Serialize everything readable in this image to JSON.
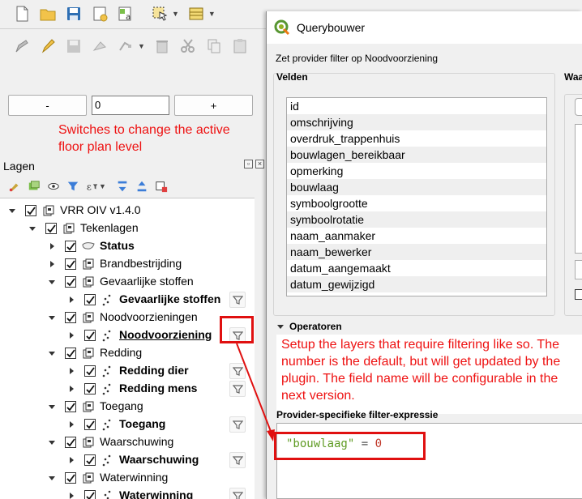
{
  "note_floor": "Switches to change the active floor plan level",
  "floor": {
    "minus_label": "-",
    "value": "0",
    "plus_label": "+"
  },
  "layers": {
    "title": "Lagen",
    "tree": [
      {
        "label": "VRR OIV v1.4.0",
        "depth": 0,
        "expanded": true,
        "checked": true,
        "icon": "group-icon",
        "bold": false
      },
      {
        "label": "Tekenlagen",
        "depth": 1,
        "expanded": true,
        "checked": true,
        "icon": "group-icon",
        "bold": false
      },
      {
        "label": "Status",
        "depth": 2,
        "expanded": false,
        "checked": true,
        "icon": "polygon-icon",
        "bold": true
      },
      {
        "label": "Brandbestrijding",
        "depth": 2,
        "expanded": false,
        "checked": true,
        "icon": "group-icon",
        "bold": false
      },
      {
        "label": "Gevaarlijke stoffen",
        "depth": 2,
        "expanded": true,
        "checked": true,
        "icon": "group-icon",
        "bold": false
      },
      {
        "label": "Gevaarlijke stoffen",
        "depth": 3,
        "expanded": false,
        "checked": true,
        "icon": "point-layer-icon",
        "bold": true,
        "filter": true
      },
      {
        "label": "Noodvoorzieningen",
        "depth": 2,
        "expanded": true,
        "checked": true,
        "icon": "group-icon",
        "bold": false
      },
      {
        "label": "Noodvoorziening",
        "depth": 3,
        "expanded": false,
        "checked": true,
        "icon": "point-layer-icon",
        "bold": true,
        "filter": true,
        "underline": true
      },
      {
        "label": "Redding",
        "depth": 2,
        "expanded": true,
        "checked": true,
        "icon": "group-icon",
        "bold": false
      },
      {
        "label": "Redding dier",
        "depth": 3,
        "expanded": false,
        "checked": true,
        "icon": "point-layer-icon",
        "bold": true,
        "filter": true
      },
      {
        "label": "Redding mens",
        "depth": 3,
        "expanded": false,
        "checked": true,
        "icon": "point-layer-icon",
        "bold": true,
        "filter": true
      },
      {
        "label": "Toegang",
        "depth": 2,
        "expanded": true,
        "checked": true,
        "icon": "group-icon",
        "bold": false
      },
      {
        "label": "Toegang",
        "depth": 3,
        "expanded": false,
        "checked": true,
        "icon": "point-layer-icon",
        "bold": true,
        "filter": true
      },
      {
        "label": "Waarschuwing",
        "depth": 2,
        "expanded": true,
        "checked": true,
        "icon": "group-icon",
        "bold": false
      },
      {
        "label": "Waarschuwing",
        "depth": 3,
        "expanded": false,
        "checked": true,
        "icon": "point-layer-icon",
        "bold": true,
        "filter": true
      },
      {
        "label": "Waterwinning",
        "depth": 2,
        "expanded": true,
        "checked": true,
        "icon": "group-icon",
        "bold": false
      },
      {
        "label": "Waterwinning",
        "depth": 3,
        "expanded": false,
        "checked": true,
        "icon": "point-layer-icon",
        "bold": true,
        "filter": true
      }
    ]
  },
  "dialog": {
    "title": "Querybouwer",
    "subtitle": "Zet provider filter op Noodvoorziening",
    "fields_title": "Velden",
    "values_title": "Waa",
    "fields": [
      "id",
      "omschrijving",
      "overdruk_trappenhuis",
      "bouwlagen_bereikbaar",
      "opmerking",
      "bouwlaag",
      "symboolgrootte",
      "symboolrotatie",
      "naam_aanmaker",
      "naam_bewerker",
      "datum_aangemaakt",
      "datum_gewijzigd"
    ],
    "operators_title": "Operatoren",
    "filter_note": "Setup the layers that require filtering like so. The number is the default, but will get updated by the plugin. The field name will be configurable in the next version.",
    "provider_filter_title": "Provider-specifieke filter-expressie",
    "expression": {
      "field": "\"bouwlaag\"",
      "operator": "=",
      "value": "0"
    }
  },
  "colors": {
    "annotation": "#e11111",
    "expr_string": "#5f9b23",
    "expr_number": "#c0392b"
  }
}
